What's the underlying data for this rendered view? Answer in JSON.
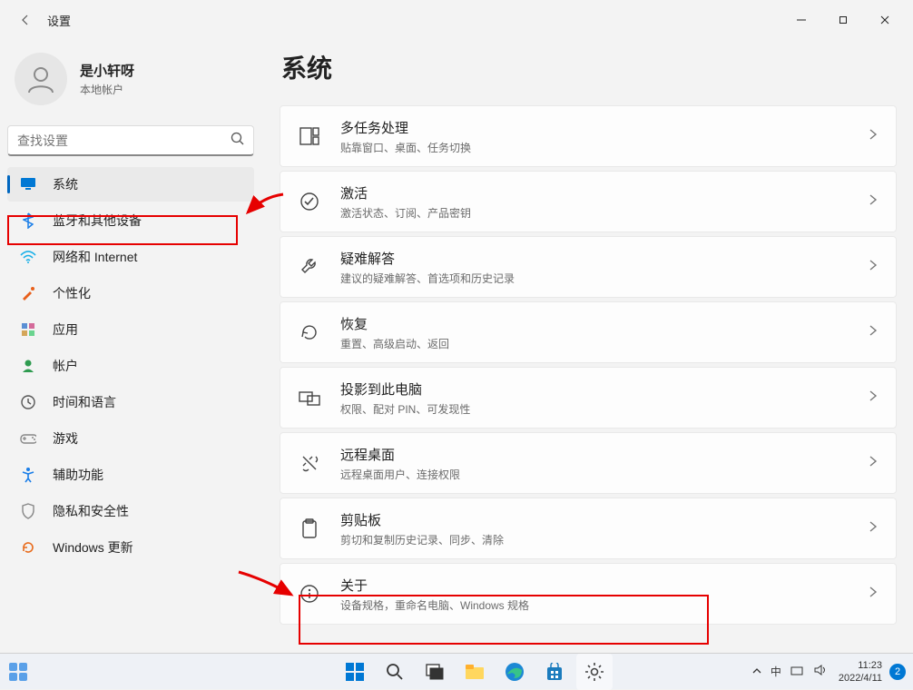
{
  "app": {
    "title": "设置"
  },
  "user": {
    "name": "是小轩呀",
    "sub": "本地帐户"
  },
  "search": {
    "placeholder": "查找设置"
  },
  "sidebar": {
    "items": [
      {
        "label": "系统",
        "icon": "monitor",
        "color": "#0078d4",
        "active": true
      },
      {
        "label": "蓝牙和其他设备",
        "icon": "bluetooth",
        "color": "#1a7ee8"
      },
      {
        "label": "网络和 Internet",
        "icon": "wifi",
        "color": "#1ab0e8"
      },
      {
        "label": "个性化",
        "icon": "brush",
        "color": "#e85f1a"
      },
      {
        "label": "应用",
        "icon": "grid",
        "color": "#c05c9e"
      },
      {
        "label": "帐户",
        "icon": "person",
        "color": "#2e9b4f"
      },
      {
        "label": "时间和语言",
        "icon": "clock",
        "color": "#555"
      },
      {
        "label": "游戏",
        "icon": "gamepad",
        "color": "#888"
      },
      {
        "label": "辅助功能",
        "icon": "accessibility",
        "color": "#1a7ee8"
      },
      {
        "label": "隐私和安全性",
        "icon": "shield",
        "color": "#888"
      },
      {
        "label": "Windows 更新",
        "icon": "update",
        "color": "#e86a1a"
      }
    ]
  },
  "content": {
    "heading": "系统",
    "cards": [
      {
        "title": "多任务处理",
        "sub": "贴靠窗口、桌面、任务切换",
        "icon": "multitask"
      },
      {
        "title": "激活",
        "sub": "激活状态、订阅、产品密钥",
        "icon": "check-circle"
      },
      {
        "title": "疑难解答",
        "sub": "建议的疑难解答、首选项和历史记录",
        "icon": "wrench"
      },
      {
        "title": "恢复",
        "sub": "重置、高级启动、返回",
        "icon": "recover"
      },
      {
        "title": "投影到此电脑",
        "sub": "权限、配对 PIN、可发现性",
        "icon": "projection"
      },
      {
        "title": "远程桌面",
        "sub": "远程桌面用户、连接权限",
        "icon": "remote"
      },
      {
        "title": "剪贴板",
        "sub": "剪切和复制历史记录、同步、清除",
        "icon": "clipboard"
      },
      {
        "title": "关于",
        "sub": "设备规格，重命名电脑、Windows 规格",
        "icon": "info"
      }
    ]
  },
  "taskbar": {
    "time": "11:23",
    "date": "2022/4/11",
    "ime": "中",
    "badge": "2"
  }
}
